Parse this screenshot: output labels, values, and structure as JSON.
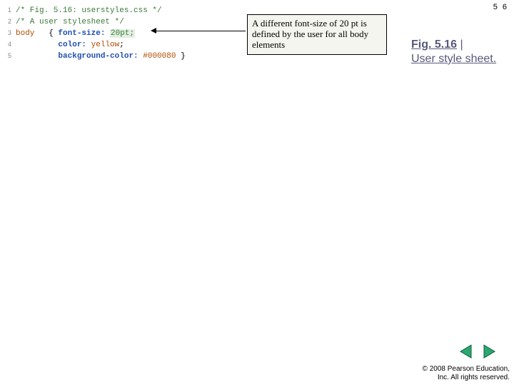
{
  "page_number": "5 6",
  "code": {
    "lines": [
      {
        "n": "1",
        "tokens": [
          {
            "t": "/* Fig. 5.16: userstyles.css */",
            "cls": "c-comment"
          }
        ]
      },
      {
        "n": "2",
        "tokens": [
          {
            "t": "/* A user stylesheet */",
            "cls": "c-comment"
          }
        ]
      },
      {
        "n": "3",
        "tokens": [
          {
            "t": "body",
            "cls": "c-keyword"
          },
          {
            "t": "   { ",
            "cls": "c-punct"
          },
          {
            "t": "font-size: ",
            "cls": "c-prop"
          },
          {
            "t": "20pt;",
            "cls": "c-highlight"
          }
        ]
      },
      {
        "n": "4",
        "tokens": [
          {
            "t": "         ",
            "cls": ""
          },
          {
            "t": "color: ",
            "cls": "c-prop"
          },
          {
            "t": "yellow",
            "cls": "c-value"
          },
          {
            "t": ";",
            "cls": "c-punct"
          }
        ]
      },
      {
        "n": "5",
        "tokens": [
          {
            "t": "         ",
            "cls": ""
          },
          {
            "t": "background-color: ",
            "cls": "c-prop"
          },
          {
            "t": "#000080 ",
            "cls": "c-value"
          },
          {
            "t": "}",
            "cls": "c-punct"
          }
        ]
      }
    ]
  },
  "callout": {
    "text": "A different font-size of 20 pt is defined by the user for all body elements"
  },
  "caption": {
    "fignum": "Fig. 5.16",
    "sep": " | ",
    "rest": "User style sheet."
  },
  "nav": {
    "prev_name": "prev-slide-icon",
    "next_name": "next-slide-icon"
  },
  "copyright": {
    "line1": "© 2008 Pearson Education,",
    "line2": "Inc.  All rights reserved."
  }
}
